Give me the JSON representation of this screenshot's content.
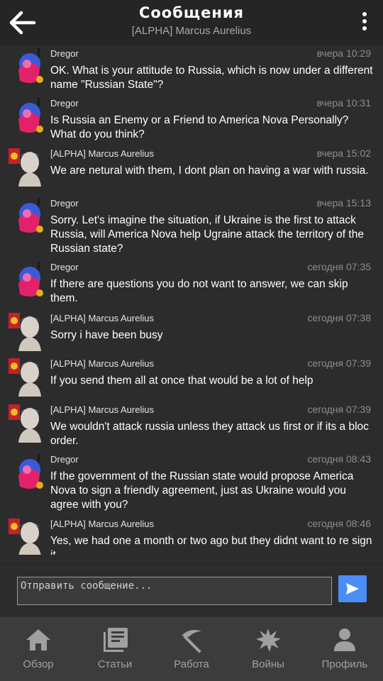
{
  "header": {
    "title": "Сообщения",
    "subtitle": "[ALPHA] Marcus Aurelius"
  },
  "messages": [
    {
      "author": "Dregor",
      "avatar": "dregor-avatar",
      "time": "вчера 10:29",
      "text": "OK. What is your attitude to Russia, which is now under a different name \"Russian State\"?"
    },
    {
      "author": "Dregor",
      "avatar": "dregor-avatar",
      "time": "вчера 10:31",
      "text": "Is Russia an Enemy or a Friend to America Nova Personally? What do you think?"
    },
    {
      "author": "[ALPHA] Marcus Aurelius",
      "avatar": "marcus-avatar",
      "time": "вчера 15:02",
      "text": "We are netural with them, I dont plan on having a war with russia."
    },
    {
      "author": "Dregor",
      "avatar": "dregor-avatar",
      "time": "вчера 15:13",
      "text": "Sorry. Let's imagine the situation, if Ukraine is the first to attack Russia, will America Nova help Ugraine attack the territory of the Russian state?"
    },
    {
      "author": "Dregor",
      "avatar": "dregor-avatar",
      "time": "сегодня 07:35",
      "text": "If there are questions you do not want to answer, we can skip them."
    },
    {
      "author": "[ALPHA] Marcus Aurelius",
      "avatar": "marcus-avatar",
      "time": "сегодня 07:38",
      "text": "Sorry i have been busy"
    },
    {
      "author": "[ALPHA] Marcus Aurelius",
      "avatar": "marcus-avatar",
      "time": "сегодня 07:39",
      "text": "If you send them all at once that would be a lot of help"
    },
    {
      "author": "[ALPHA] Marcus Aurelius",
      "avatar": "marcus-avatar",
      "time": "сегодня 07:39",
      "text": "We wouldn't attack russia unless they attack us first or if its a bloc order."
    },
    {
      "author": "Dregor",
      "avatar": "dregor-avatar",
      "time": "сегодня 08:43",
      "text": "If the government of the Russian state would propose America Nova to sign a friendly agreement, just as Ukraine would you agree with you?"
    },
    {
      "author": "[ALPHA] Marcus Aurelius",
      "avatar": "marcus-avatar",
      "time": "сегодня 08:46",
      "text": "Yes, we had one a month or two ago but they didnt want to re sign it."
    }
  ],
  "composer": {
    "placeholder": "Отправить сообщение...",
    "value": ""
  },
  "nav": {
    "items": [
      {
        "label": "Обзор",
        "icon": "home-icon"
      },
      {
        "label": "Статьи",
        "icon": "articles-icon"
      },
      {
        "label": "Работа",
        "icon": "pickaxe-icon"
      },
      {
        "label": "Войны",
        "icon": "explosion-icon"
      },
      {
        "label": "Профиль",
        "icon": "profile-icon"
      }
    ]
  },
  "colors": {
    "header_bg": "#252525",
    "page_bg": "#2c2c2c",
    "nav_bg": "#3c3c3c",
    "accent": "#4a8df7",
    "muted_text": "#8e8e8e"
  }
}
